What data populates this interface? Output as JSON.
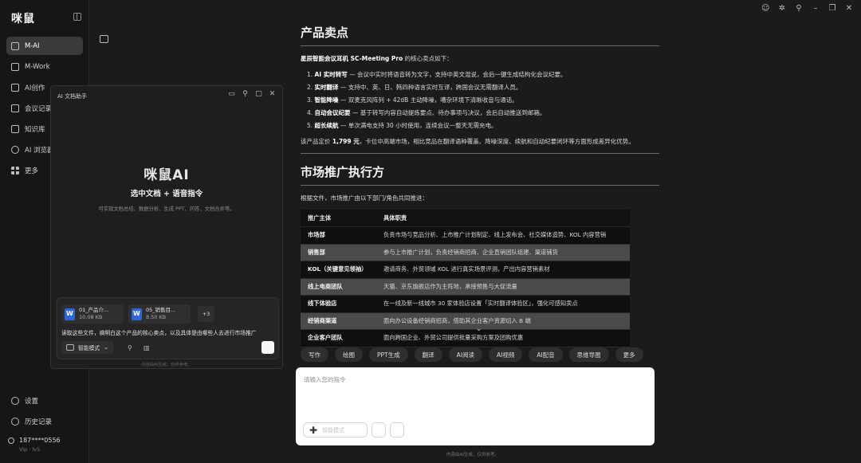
{
  "app": {
    "logo": "咪鼠"
  },
  "sidebar": {
    "items": [
      {
        "label": "M-AI",
        "icon": "chat-icon",
        "active": true
      },
      {
        "label": "M-Work",
        "icon": "work-icon",
        "active": false
      },
      {
        "label": "AI创作",
        "icon": "image-icon",
        "active": false
      },
      {
        "label": "会议记录",
        "icon": "record-icon",
        "active": false
      },
      {
        "label": "知识库",
        "icon": "book-icon",
        "active": false
      },
      {
        "label": "AI 浏览器",
        "icon": "compass-icon",
        "active": false
      },
      {
        "label": "更多",
        "icon": "grid-icon",
        "active": false
      }
    ],
    "bottom": [
      {
        "label": "设置",
        "icon": "gear-icon"
      },
      {
        "label": "历史记录",
        "icon": "history-icon"
      }
    ],
    "user": {
      "name": "187****0556",
      "tier": "Vip",
      "level": "lv5"
    }
  },
  "document": {
    "section1": {
      "title": "产品卖点",
      "intro_bold": "星辰智能会议耳机 SC-Meeting Pro",
      "intro_rest": " 的核心卖点如下：",
      "points": [
        {
          "n": "1.",
          "bold": "AI 实时转写",
          "text": " — 会议中实时将语音转为文字，支持中英文混说，会后一键生成结构化会议纪要。"
        },
        {
          "n": "2.",
          "bold": "实时翻译",
          "text": " — 支持中、英、日、韩四种语言实时互译，跨国会议无需翻译人员。"
        },
        {
          "n": "3.",
          "bold": "智能降噪",
          "text": " — 双麦克风阵列 + 42dB 主动降噪，嘈杂环境下清晰收音与通话。"
        },
        {
          "n": "4.",
          "bold": "自动会议纪要",
          "text": " — 基于转写内容自动提炼要点、待办事项与决议，会后自动推送到邮箱。"
        },
        {
          "n": "5.",
          "bold": "超长续航",
          "text": " — 单次满电支持 30 小时使用，连续会议一整天无需充电。"
        }
      ],
      "summary_a": "该产品定价 ",
      "summary_price": "1,799 元",
      "summary_b": "，卡位中高端市场，相比竞品在翻译语种覆盖、降噪深度、续航和自动纪要闭环等方面形成差异化优势。"
    },
    "section2": {
      "title": "市场推广执行方",
      "intro": "根据文件，市场推广由以下部门/角色共同推进：",
      "headers": [
        "推广主体",
        "具体职责"
      ],
      "rows": [
        [
          "市场部",
          "负责市场与竞品分析、上市推广计划制定、线上发布会、社交媒体造势、KOL 内容营销"
        ],
        [
          "销售部",
          "参与上市推广计划，负责经销商招商、企业直销团队组建、渠道铺货"
        ],
        [
          "KOL（关键意见领袖）",
          "邀请商务、外贸领域 KOL 进行真实场景评测，产出内容营销素材"
        ],
        [
          "线上电商团队",
          "天猫、京东旗舰店作为主阵地，承接预售与大促流量"
        ],
        [
          "线下体验店",
          "在一线及新一线城市 30 家体验店设置「实时翻译体验区」，强化可感知卖点"
        ],
        [
          "经销商渠道",
          "面向办公设备经销商招商，借助其企业客户资源切入 B 端"
        ],
        [
          "企业客户团队",
          "面向跨国企业、外贸公司提供批量采购方案及团购优惠"
        ]
      ]
    }
  },
  "quick_actions": [
    "写作",
    "绘图",
    "PPT生成",
    "翻译",
    "AI阅读",
    "AI视频",
    "AI配音",
    "思维导图",
    "更多"
  ],
  "prompt": {
    "placeholder": "请输入您的指令",
    "mode_label": "智能模式"
  },
  "disclaimer": "内容由AI生成，仅供参考。",
  "panel": {
    "title": "AI 文档助手",
    "logo": "咪鼠AI",
    "headline": "选中文档 + 语音指令",
    "subtitle": "可实现文档总结、数据分析、生成 PPT、问答、文档合并等。",
    "files": [
      {
        "name": "01_产品介...",
        "size": "10.08 KB"
      },
      {
        "name": "05_销售目...",
        "size": "8.50 KB"
      }
    ],
    "more_count": "+3",
    "query": "读取这些文件，搞明白这个产品的核心卖点，以及具体是由哪些人去进行市场推广",
    "mode": "智能模式",
    "disclaimer": "内容由AI生成，仅供参考。"
  }
}
